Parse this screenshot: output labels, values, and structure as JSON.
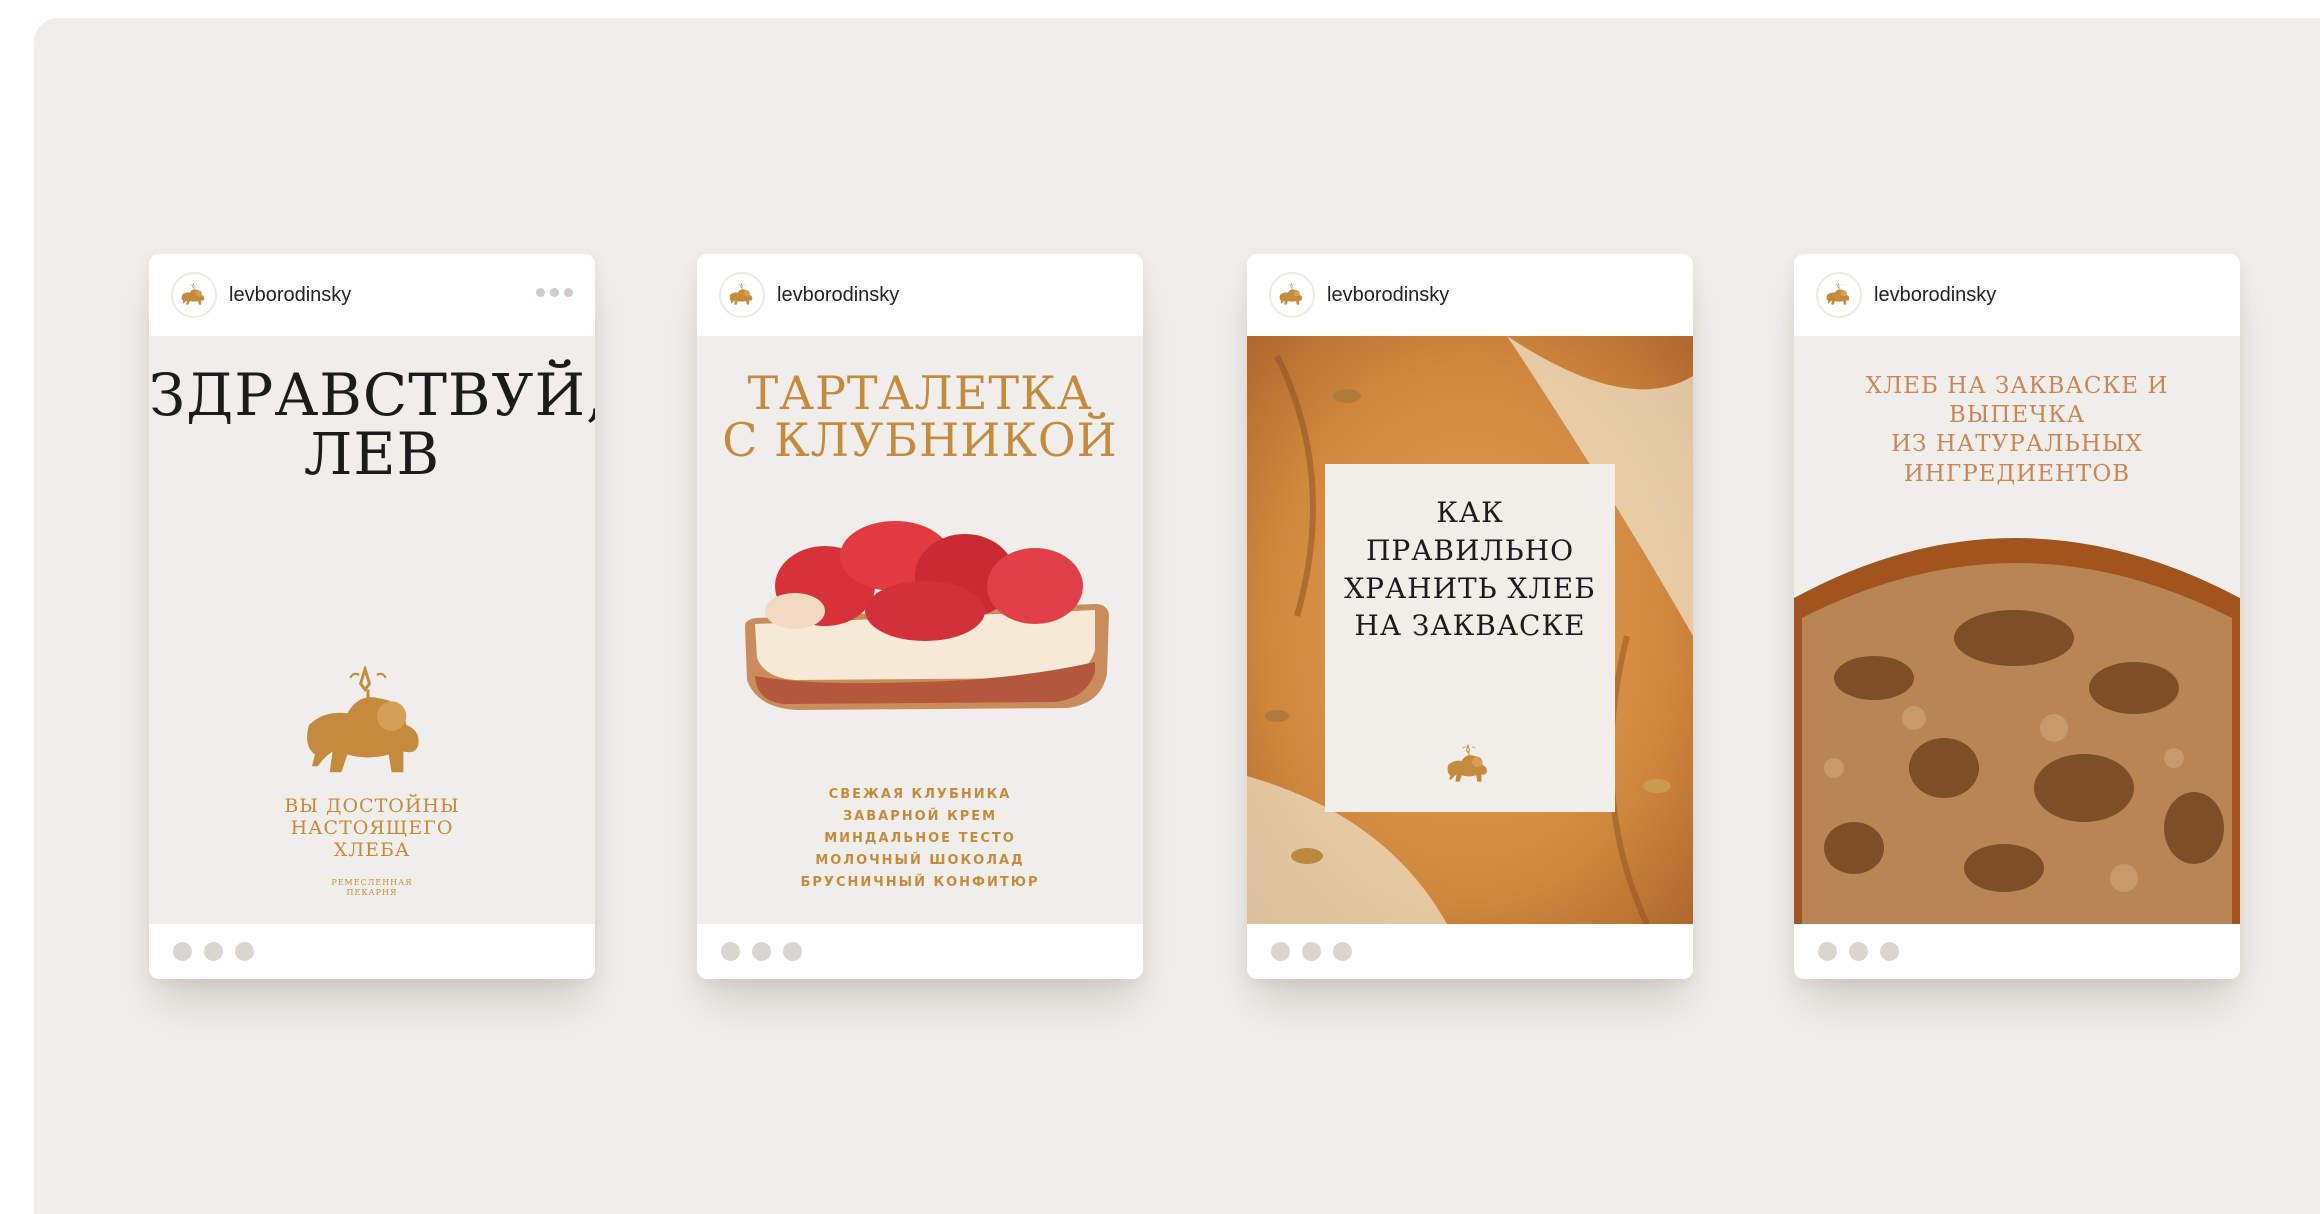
{
  "posts": [
    {
      "username": "levborodinsky",
      "title_line1": "Здравствуй,",
      "title_line2": "лев",
      "tagline_line1": "Вы достойны",
      "tagline_line2": "настоящего",
      "tagline_line3": "хлеба",
      "small_line1": "ремесленная",
      "small_line2": "пекарня"
    },
    {
      "username": "levborodinsky",
      "title_line1": "Тарталетка",
      "title_line2": "с клубникой",
      "ingredients": [
        "СВЕЖАЯ КЛУБНИКА",
        "ЗАВАРНОЙ КРЕМ",
        "МИНДАЛЬНОЕ ТЕСТО",
        "МОЛОЧНЫЙ ШОКОЛАД",
        "БРУСНИЧНЫЙ КОНФИТЮР"
      ]
    },
    {
      "username": "levborodinsky",
      "title_line1": "Как",
      "title_line2": "правильно",
      "title_line3": "хранить хлеб",
      "title_line4": "на закваске"
    },
    {
      "username": "levborodinsky",
      "title_line1": "Хлеб на закваске и выпечка",
      "title_line2": "из натуральных",
      "title_line3": "ингредиентов"
    }
  ],
  "colors": {
    "canvas": "#f0eeeb",
    "gold": "#c48b3e",
    "text_dark": "#1b1b1b",
    "dot_grey": "#d9d6d2"
  },
  "icons": {
    "avatar": "lion-logo-icon",
    "menu": "more-dots-icon",
    "footer": "pagination-dot"
  }
}
